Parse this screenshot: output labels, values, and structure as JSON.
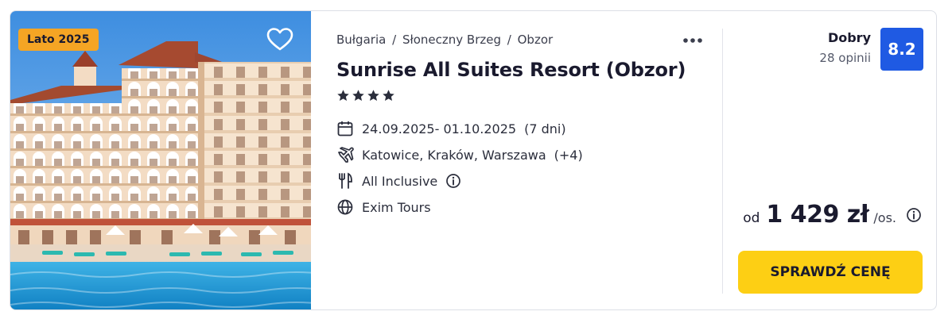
{
  "offer": {
    "season_badge": "Lato 2025",
    "breadcrumb": [
      "Bułgaria",
      "Słoneczny Brzeg",
      "Obzor"
    ],
    "breadcrumb_sep": "/",
    "hotel_name": "Sunrise All Suites Resort (Obzor)",
    "stars": 4,
    "dates": "24.09.2025- 01.10.2025",
    "duration": "(7 dni)",
    "departure": "Katowice, Kraków, Warszawa",
    "departure_more": "(+4)",
    "board": "All Inclusive",
    "operator": "Exim Tours"
  },
  "rating": {
    "label": "Dobry",
    "count": "28 opinii",
    "score": "8.2"
  },
  "price": {
    "prefix": "od",
    "value": "1 429 zł",
    "suffix": "/os."
  },
  "cta_label": "SPRAWDŹ CENĘ",
  "icons": {
    "favorite": "heart-outline-icon",
    "more": "more-dots-icon",
    "dates": "calendar-icon",
    "departure": "plane-icon",
    "board": "cutlery-icon",
    "operator": "globe-icon",
    "info": "info-icon"
  },
  "colors": {
    "badge": "#f5a524",
    "score": "#1f5ae3",
    "cta": "#fdcf14"
  }
}
